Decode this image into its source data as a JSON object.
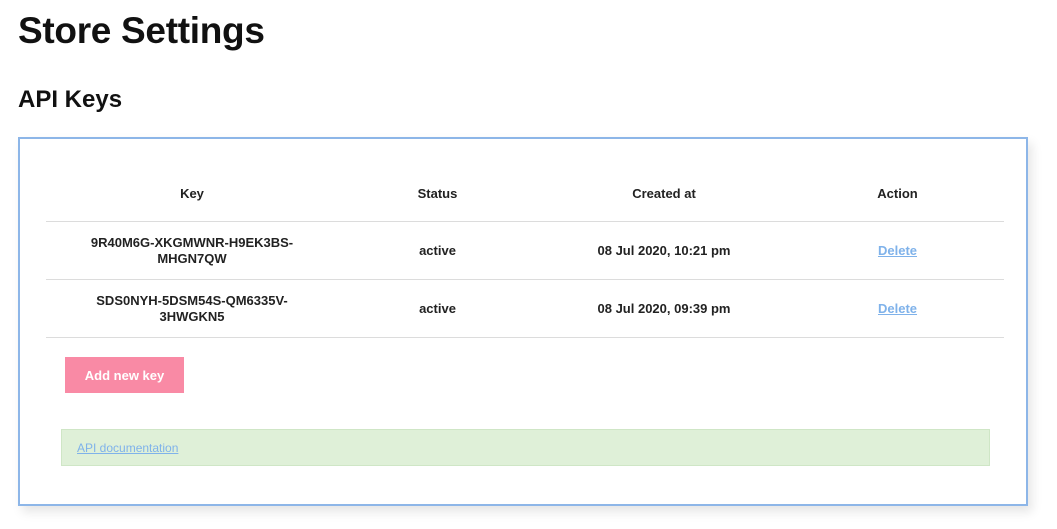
{
  "page": {
    "title": "Store Settings"
  },
  "api_keys": {
    "section_title": "API Keys",
    "columns": {
      "key": "Key",
      "status": "Status",
      "created_at": "Created at",
      "action": "Action"
    },
    "rows": [
      {
        "key": "9R40M6G-XKGMWNR-H9EK3BS-MHGN7QW",
        "status": "active",
        "created_at": "08 Jul 2020, 10:21 pm",
        "action": "Delete"
      },
      {
        "key": "SDS0NYH-5DSM54S-QM6335V-3HWGKN5",
        "status": "active",
        "created_at": "08 Jul 2020, 09:39 pm",
        "action": "Delete"
      }
    ],
    "add_button_label": "Add new key",
    "doc_link_label": "API documentation"
  },
  "colors": {
    "card_border": "#8db6e8",
    "button_bg": "#f98aa5",
    "link": "#7fb2ea",
    "doc_bar_bg": "#dff0d8"
  }
}
